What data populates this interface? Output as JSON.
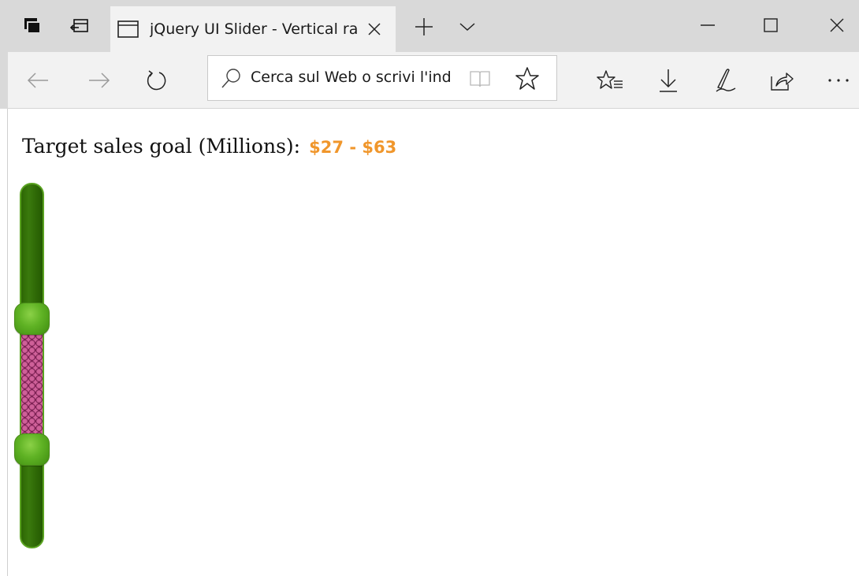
{
  "browser": {
    "tab": {
      "title": "jQuery UI Slider - Vertical range slider"
    },
    "address_bar": {
      "placeholder": "Cerca sul Web o scrivi l'indirizzo"
    },
    "icons": {
      "set_aside_tabs": "tabs-aside-icon",
      "show_tabs": "show-tabs-icon",
      "tab_page": "page-icon",
      "tab_close": "close-icon",
      "new_tab": "plus-icon",
      "tab_preview": "chevron-down-icon",
      "minimize": "minimize-icon",
      "maximize": "maximize-icon",
      "close_window": "close-icon",
      "back": "back-arrow-icon",
      "forward": "forward-arrow-icon",
      "refresh": "refresh-icon",
      "search": "search-icon",
      "reading_view": "book-icon",
      "favorite": "star-icon",
      "favorites_hub": "favorites-icon",
      "downloads": "download-icon",
      "notes": "pen-icon",
      "share": "share-icon",
      "more": "more-icon"
    }
  },
  "page": {
    "goal_label": "Target sales goal (Millions):",
    "goal_value": "$27 - $63",
    "slider": {
      "orientation": "vertical",
      "min": 0,
      "max": 100,
      "values": [
        27,
        63
      ]
    }
  },
  "colors": {
    "value_text": "#f0962b",
    "slider_track": "#2f6b06",
    "slider_range": "#a6336f",
    "slider_handle": "#5fb224"
  }
}
